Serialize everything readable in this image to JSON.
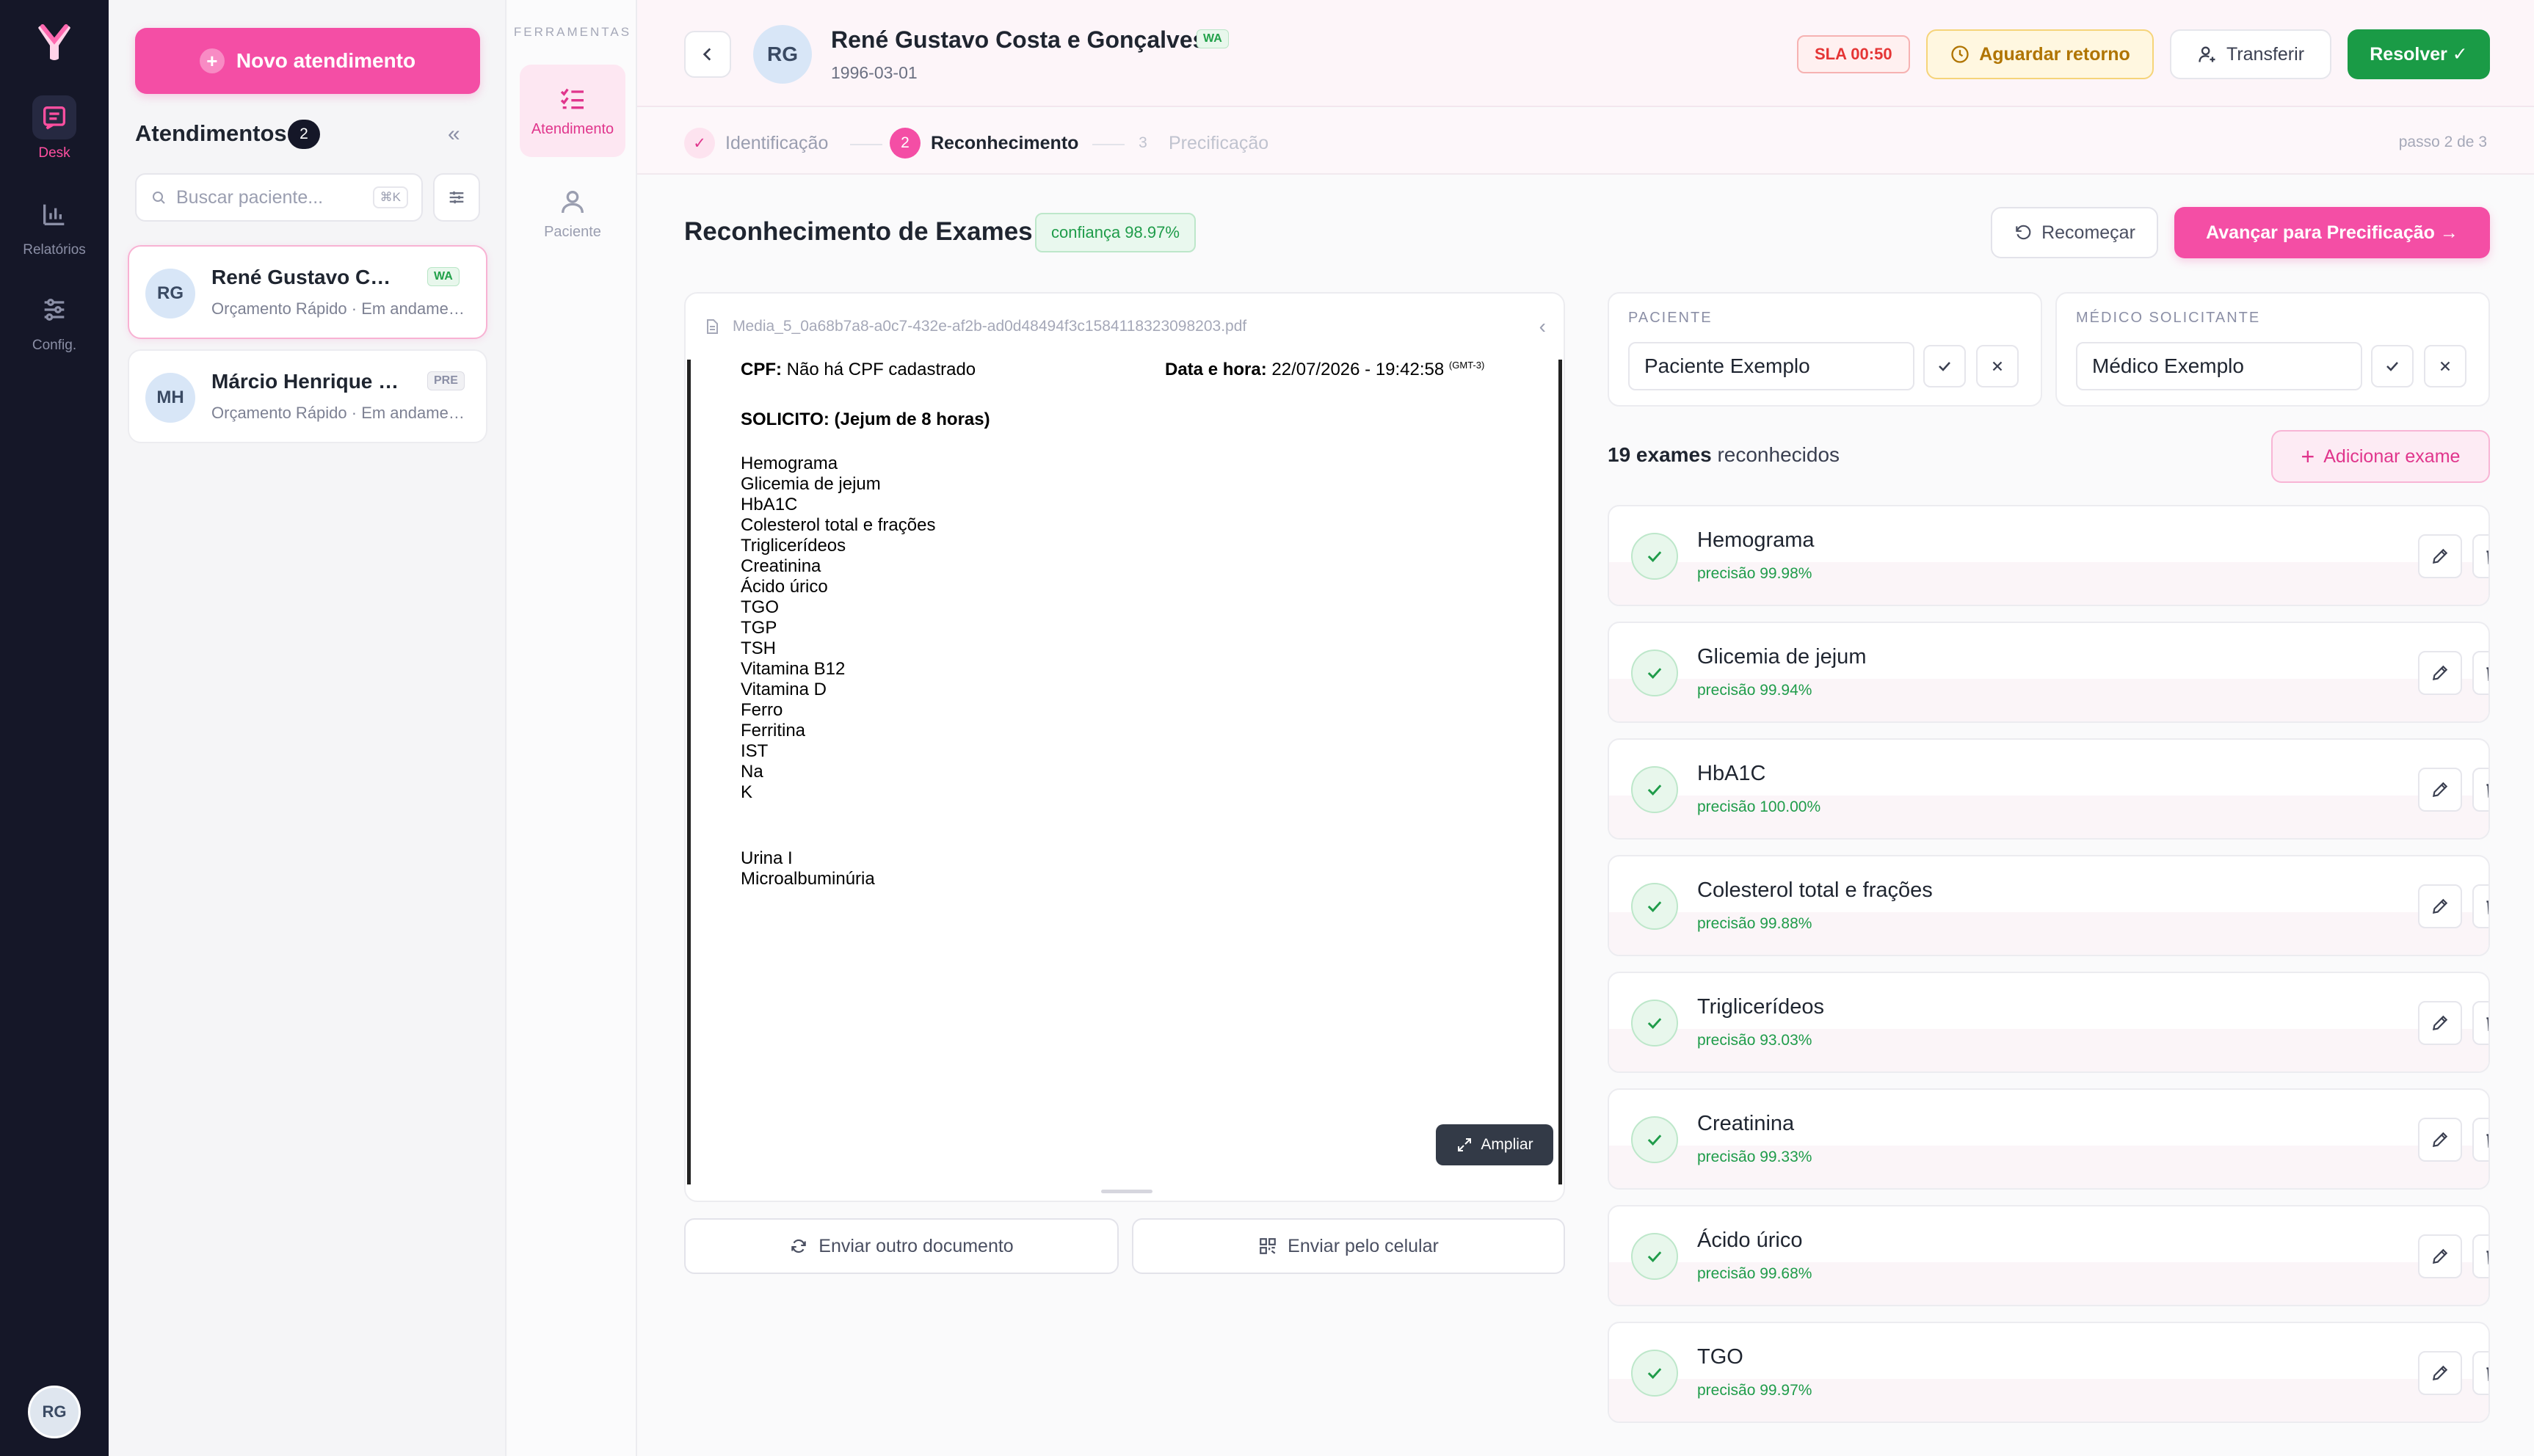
{
  "rail": {
    "items": [
      {
        "label": "Desk",
        "icon": "message-square-icon",
        "active": true
      },
      {
        "label": "Relatórios",
        "icon": "bar-chart-icon",
        "active": false
      },
      {
        "label": "Config.",
        "icon": "sliders-icon",
        "active": false
      }
    ],
    "user_initials": "RG"
  },
  "sidebar": {
    "new_button": "Novo atendimento",
    "title": "Atendimentos",
    "count": "2",
    "search_placeholder": "Buscar paciente...",
    "search_shortcut": "⌘K",
    "conversations": [
      {
        "initials": "RG",
        "name": "René Gustavo Costa e Gonçalves",
        "tag": "WA",
        "subtitle": "Orçamento Rápido · Em andamento"
      },
      {
        "initials": "MH",
        "name": "Márcio Henrique de Souza",
        "tag": "PRE",
        "subtitle": "Orçamento Rápido · Em andamento"
      }
    ]
  },
  "tools": {
    "label": "FERRAMENTAS",
    "items": [
      {
        "label": "Atendimento",
        "icon": "checklist-icon",
        "active": true
      },
      {
        "label": "Paciente",
        "icon": "user-icon",
        "active": false
      }
    ]
  },
  "header": {
    "initials": "RG",
    "name": "René Gustavo Costa e Gonçalves",
    "tag": "WA",
    "dob": "1996-03-01",
    "sla": "SLA 00:50",
    "wait_button": "Aguardar retorno",
    "transfer_button": "Transferir",
    "resolve_button": "Resolver ✓"
  },
  "stepper": {
    "steps": [
      {
        "num": "✓",
        "label": "Identificação",
        "state": "done"
      },
      {
        "num": "2",
        "label": "Reconhecimento",
        "state": "current"
      },
      {
        "num": "3",
        "label": "Precificação",
        "state": "future"
      }
    ],
    "progress": "passo 2 de 3"
  },
  "section": {
    "title": "Reconhecimento de Exames",
    "confidence": "confiança 98.97%",
    "restart_button": "Recomeçar",
    "advance_button": "Avançar para Precificação →"
  },
  "document": {
    "filename": "Media_5_0a68b7a8-a0c7-432e-af2b-ad0d48494f3c1584118323098203.pdf",
    "cpf_label": "CPF:",
    "cpf_value": "Não há CPF cadastrado",
    "date_label": "Data e hora:",
    "date_value": "22/07/2026 - 19:42:58",
    "tz": "(GMT-3)",
    "request_title": "SOLICITO: (Jejum de 8 horas)",
    "exams": [
      "Hemograma",
      "Glicemia de jejum",
      "HbA1C",
      "Colesterol total e frações",
      "Triglicerídeos",
      "Creatinina",
      "Ácido úrico",
      "TGO",
      "TGP",
      "TSH",
      "Vitamina B12",
      "Vitamina D",
      "Ferro",
      "Ferritina",
      "IST",
      "Na",
      "K"
    ],
    "exams_extra": [
      "Urina I",
      "Microalbuminúria"
    ],
    "zoom_button": "Ampliar",
    "send_other": "Enviar outro documento",
    "send_phone": "Enviar pelo celular"
  },
  "fields": {
    "patient_label": "PACIENTE",
    "patient_value": "Paciente Exemplo",
    "doctor_label": "MÉDICO SOLICITANTE",
    "doctor_value": "Médico Exemplo"
  },
  "exams_panel": {
    "count_number": "19 exames",
    "count_suffix": " reconhecidos",
    "add_button": "Adicionar exame",
    "items": [
      {
        "name": "Hemograma",
        "precision": "precisão 99.98%"
      },
      {
        "name": "Glicemia de jejum",
        "precision": "precisão 99.94%"
      },
      {
        "name": "HbA1C",
        "precision": "precisão 100.00%"
      },
      {
        "name": "Colesterol total e frações",
        "precision": "precisão 99.88%"
      },
      {
        "name": "Triglicerídeos",
        "precision": "precisão 93.03%"
      },
      {
        "name": "Creatinina",
        "precision": "precisão 99.33%"
      },
      {
        "name": "Ácido úrico",
        "precision": "precisão 99.68%"
      },
      {
        "name": "TGO",
        "precision": "precisão 99.97%"
      }
    ]
  },
  "colors": {
    "accent": "#f44ea5",
    "success": "#1a9b46",
    "rail": "#151728"
  }
}
